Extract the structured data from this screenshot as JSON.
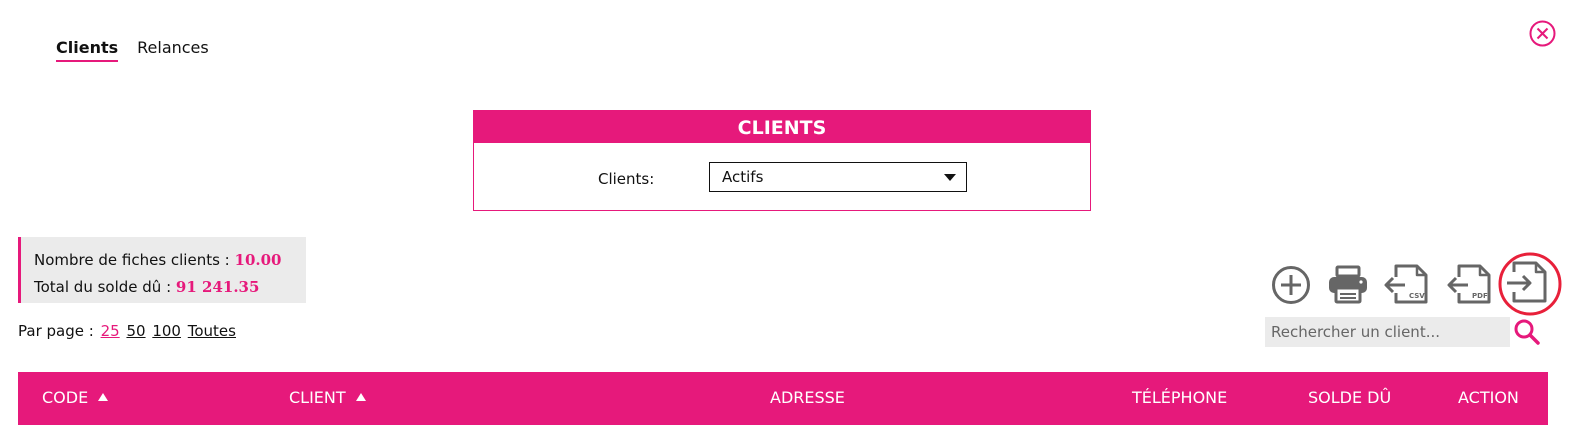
{
  "tabs": [
    {
      "label": "Clients",
      "active": true
    },
    {
      "label": "Relances",
      "active": false
    }
  ],
  "filter": {
    "title": "CLIENTS",
    "label": "Clients:",
    "selected": "Actifs"
  },
  "stats": {
    "count_label": "Nombre de fiches clients :",
    "count_value": "10.00",
    "balance_label": "Total du solde dû :",
    "balance_value": "91 241.35"
  },
  "pagination": {
    "label": "Par page :",
    "options": [
      "25",
      "50",
      "100",
      "Toutes"
    ],
    "selected": "25"
  },
  "toolbar": {
    "icons": [
      "add-circle-icon",
      "print-icon",
      "export-csv-icon",
      "export-pdf-icon",
      "import-icon"
    ],
    "csv_text": "CSV",
    "pdf_text": "PDF"
  },
  "search": {
    "placeholder": "Rechercher un client..."
  },
  "table": {
    "columns": [
      {
        "label": "CODE",
        "sortable": true
      },
      {
        "label": "CLIENT",
        "sortable": true
      },
      {
        "label": "ADRESSE",
        "sortable": false
      },
      {
        "label": "TÉLÉPHONE",
        "sortable": false
      },
      {
        "label": "SOLDE DÛ",
        "sortable": false
      },
      {
        "label": "ACTION",
        "sortable": false
      }
    ]
  },
  "colors": {
    "accent": "#e6197b",
    "icon_gray": "#666666",
    "highlight_ring": "#e8203a",
    "panel_gray": "#ebebeb"
  }
}
